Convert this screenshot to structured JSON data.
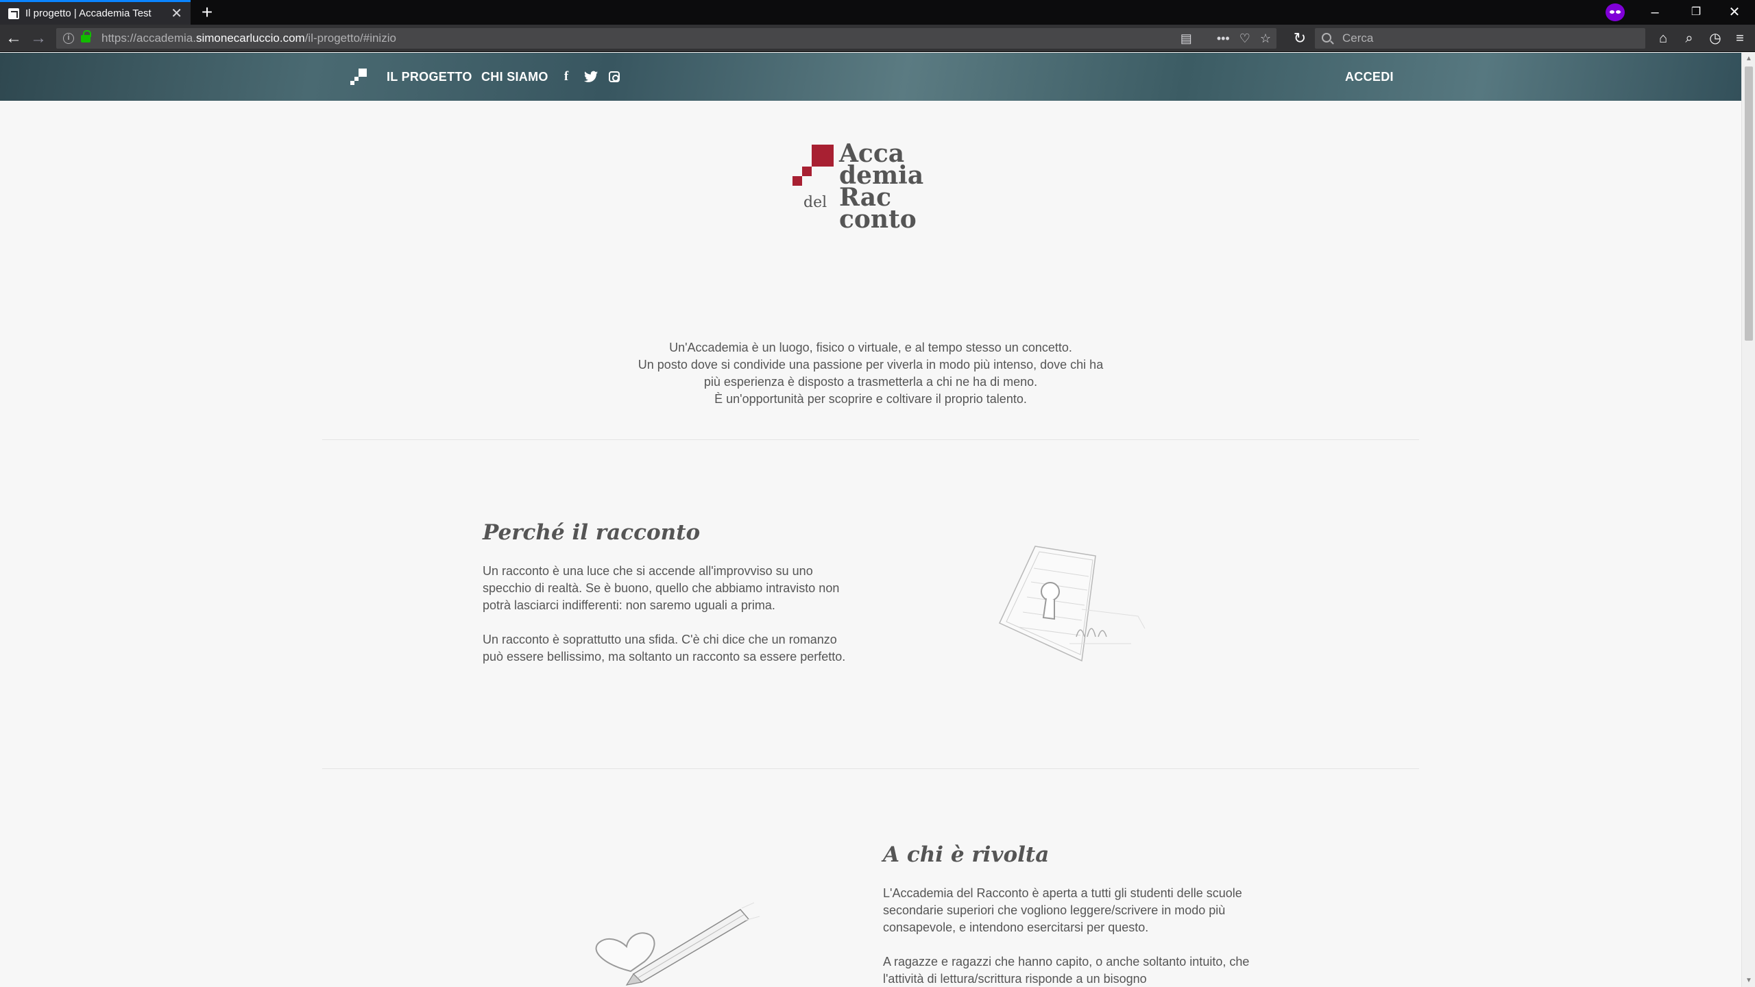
{
  "browser": {
    "tab_title": "Il progetto | Accademia Test",
    "tab_close": "✕",
    "new_tab": "+",
    "url_prefix": "https://accademia.",
    "url_host": "simonecarluccio.com",
    "url_path": "/il-progetto/#inizio",
    "search_placeholder": "Cerca",
    "window_minimize": "–",
    "window_restore": "❐",
    "window_close": "✕"
  },
  "site_nav": {
    "items": [
      "IL PROGETTO",
      "CHI SIAMO"
    ],
    "social": [
      "facebook-icon",
      "twitter-icon",
      "instagram-icon"
    ],
    "login": "ACCEDI"
  },
  "brand": {
    "lines": [
      "Acca",
      "demia",
      "del",
      "Rac",
      "conto"
    ],
    "accent_color": "#a82032"
  },
  "intro": {
    "lines": [
      "Un'Accademia è un luogo, fisico o virtuale, e al tempo stesso un concetto.",
      "Un posto dove si condivide una passione per viverla in modo più intenso, dove chi ha",
      "più esperienza è disposto a trasmetterla a chi ne ha di meno.",
      "È un'opportunità per scoprire e coltivare il proprio talento."
    ]
  },
  "sections": [
    {
      "title": "Perché il racconto",
      "paragraphs": [
        "Un racconto è una luce che si accende all'improvviso su uno specchio di realtà. Se è buono, quello che abbiamo intravisto non potrà lasciarci indifferenti: non saremo uguali a prima.",
        "Un racconto è soprattutto una sfida. C'è chi dice che un romanzo può essere bellissimo, ma soltanto un racconto sa essere perfetto."
      ]
    },
    {
      "title": "A chi è rivolta",
      "paragraphs": [
        "L'Accademia del Racconto è aperta a tutti gli studenti delle scuole secondarie superiori che vogliono leggere/scrivere in modo più consapevole, e intendono esercitarsi per questo.",
        "A ragazze e ragazzi che hanno capito, o anche soltanto intuito, che l'attività di lettura/scrittura risponde a un bisogno"
      ]
    }
  ]
}
